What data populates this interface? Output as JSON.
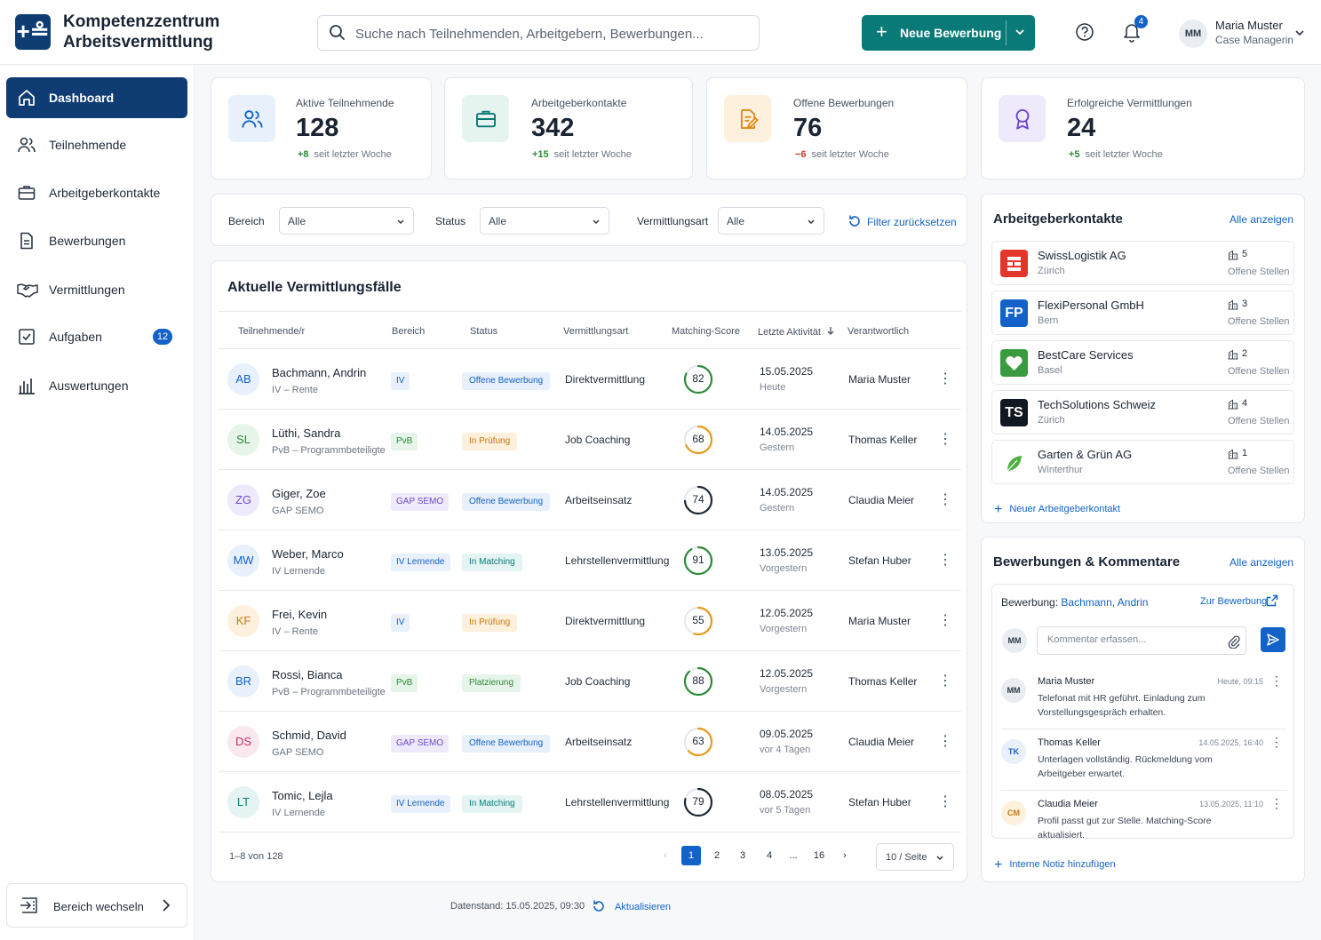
{
  "app": {
    "brand_line1": "Kompetenzzentrum",
    "brand_line2": "Arbeitsvermittlung",
    "logo_glyph": "+≗"
  },
  "search": {
    "placeholder": "Suche nach Teilnehmenden, Arbeitgebern, Bewerbungen..."
  },
  "header": {
    "new_button": "Neue Bewerbung",
    "notification_count": "4",
    "user_initials": "MM",
    "user_name": "Maria Muster",
    "user_role": "Case Managerin"
  },
  "sidebar": {
    "items": [
      {
        "label": "Dashboard",
        "icon": "home-icon",
        "active": true
      },
      {
        "label": "Teilnehmende",
        "icon": "users-icon"
      },
      {
        "label": "Arbeitgeberkontakte",
        "icon": "briefcase-icon"
      },
      {
        "label": "Bewerbungen",
        "icon": "document-icon"
      },
      {
        "label": "Vermittlungen",
        "icon": "handshake-icon"
      },
      {
        "label": "Aufgaben",
        "icon": "checkbox-icon",
        "badge": "12"
      },
      {
        "label": "Auswertungen",
        "icon": "bar-chart-icon"
      }
    ],
    "switch_label": "Bereich wechseln"
  },
  "kpis": [
    {
      "label": "Aktive Teilnehmende",
      "value": "128",
      "delta": "+8",
      "delta_text": "seit letzter Woche",
      "icon": "users-icon"
    },
    {
      "label": "Arbeitgeberkontakte",
      "value": "342",
      "delta": "+15",
      "delta_text": "seit letzter Woche",
      "icon": "briefcase-icon"
    },
    {
      "label": "Offene Bewerbungen",
      "value": "76",
      "delta": "−6",
      "delta_text": "seit letzter Woche",
      "icon": "document-edit-icon"
    },
    {
      "label": "Erfolgreiche Vermittlungen",
      "value": "24",
      "delta": "+5",
      "delta_text": "seit letzter Woche",
      "icon": "award-icon"
    }
  ],
  "filters": {
    "bereich_label": "Bereich",
    "bereich_value": "Alle",
    "status_label": "Status",
    "status_value": "Alle",
    "art_label": "Vermittlungsart",
    "art_value": "Alle",
    "reset": "Filter zurücksetzen"
  },
  "table": {
    "title": "Aktuelle Vermittlungsfälle",
    "headers": [
      "Teilnehmende/r",
      "Bereich",
      "Status",
      "Vermittlungsart",
      "Matching-Score",
      "Letzte Aktivität",
      "Verantwortlich"
    ],
    "rows": [
      {
        "initials": "AB",
        "name": "Bachmann, Andrin",
        "sub": "IV – Rente",
        "bereich": "IV",
        "status": "Offene Bewerbung",
        "art": "Direktvermittlung",
        "score": 82,
        "date": "15.05.2025",
        "when": "Heute",
        "owner": "Maria Muster"
      },
      {
        "initials": "SL",
        "name": "Lüthi, Sandra",
        "sub": "PvB – Programmbeteiligte",
        "bereich": "PvB",
        "status": "In Prüfung",
        "art": "Job Coaching",
        "score": 68,
        "date": "14.05.2025",
        "when": "Gestern",
        "owner": "Thomas Keller"
      },
      {
        "initials": "ZG",
        "name": "Giger, Zoe",
        "sub": "GAP SEMO",
        "bereich": "GAP SEMO",
        "status": "Offene Bewerbung",
        "art": "Arbeitseinsatz",
        "score": 74,
        "date": "14.05.2025",
        "when": "Gestern",
        "owner": "Claudia Meier"
      },
      {
        "initials": "MW",
        "name": "Weber, Marco",
        "sub": "IV Lernende",
        "bereich": "IV Lernende",
        "status": "In Matching",
        "art": "Lehrstellenvermittlung",
        "score": 91,
        "date": "13.05.2025",
        "when": "Vorgestern",
        "owner": "Stefan Huber"
      },
      {
        "initials": "KF",
        "name": "Frei, Kevin",
        "sub": "IV – Rente",
        "bereich": "IV",
        "status": "In Prüfung",
        "art": "Direktvermittlung",
        "score": 55,
        "date": "12.05.2025",
        "when": "Vorgestern",
        "owner": "Maria Muster"
      },
      {
        "initials": "BR",
        "name": "Rossi, Bianca",
        "sub": "PvB – Programmbeteiligte",
        "bereich": "PvB",
        "status": "Platzierung",
        "art": "Job Coaching",
        "score": 88,
        "date": "12.05.2025",
        "when": "Vorgestern",
        "owner": "Thomas Keller"
      },
      {
        "initials": "DS",
        "name": "Schmid, David",
        "sub": "GAP SEMO",
        "bereich": "GAP SEMO",
        "status": "Offene Bewerbung",
        "art": "Arbeitseinsatz",
        "score": 63,
        "date": "09.05.2025",
        "when": "vor 4 Tagen",
        "owner": "Claudia Meier"
      },
      {
        "initials": "LT",
        "name": "Tomic, Lejla",
        "sub": "IV Lernende",
        "bereich": "IV Lernende",
        "status": "In Matching",
        "art": "Lehrstellenvermittlung",
        "score": 79,
        "date": "08.05.2025",
        "when": "vor 5 Tagen",
        "owner": "Stefan Huber"
      }
    ],
    "pagination": {
      "info": "1–8 von 128",
      "pages": [
        "1",
        "2",
        "3",
        "4",
        "...",
        "16"
      ],
      "current": "1",
      "page_size": "10 / Seite"
    }
  },
  "footer": {
    "stand": "Datenstand: 15.05.2025, 09:30",
    "refresh": "Aktualisieren"
  },
  "employers": {
    "title": "Arbeitgeberkontakte",
    "all_link": "Alle anzeigen",
    "open_label": "Offene Stellen",
    "items": [
      {
        "name": "SwissLogistik AG",
        "city": "Zürich",
        "open": "5",
        "logo": "red-blocks-logo",
        "color": "#e2352b"
      },
      {
        "name": "FlexiPersonal GmbH",
        "city": "Bern",
        "open": "3",
        "logo": "FP",
        "color": "#1262c8"
      },
      {
        "name": "BestCare Services",
        "city": "Basel",
        "open": "2",
        "logo": "heart-logo",
        "color": "#3a9a3f"
      },
      {
        "name": "TechSolutions Schweiz",
        "city": "Zürich",
        "open": "4",
        "logo": "TS",
        "color": "#121821"
      },
      {
        "name": "Garten & Grün AG",
        "city": "Winterthur",
        "open": "1",
        "logo": "leaf-logo",
        "color": "#ffffff"
      }
    ],
    "add_link": "Neuer Arbeitgeberkontakt"
  },
  "comments": {
    "title": "Bewerbungen & Kommentare",
    "all_link": "Alle anzeigen",
    "application_label": "Bewerbung:",
    "application_name": "Bachmann, Andrin",
    "goto": "Zur Bewerbung",
    "me_initials": "MM",
    "placeholder": "Kommentar erfassen...",
    "items": [
      {
        "initials": "MM",
        "name": "Maria Muster",
        "time": "Heute, 09:15",
        "text": "Telefonat mit HR geführt. Einladung zum Vorstellungsgespräch erhalten."
      },
      {
        "initials": "TK",
        "name": "Thomas Keller",
        "time": "14.05.2025, 16:40",
        "text": "Unterlagen vollständig. Rückmeldung vom Arbeitgeber erwartet."
      },
      {
        "initials": "CM",
        "name": "Claudia Meier",
        "time": "13.05.2025, 11:10",
        "text": "Profil passt gut zur Stelle. Matching-Score aktualisiert."
      }
    ],
    "add_note": "Interne Notiz hinzufügen"
  },
  "colors": {
    "primary": "#0f3d73",
    "accent": "#0a7a78",
    "link": "#1262c8"
  }
}
